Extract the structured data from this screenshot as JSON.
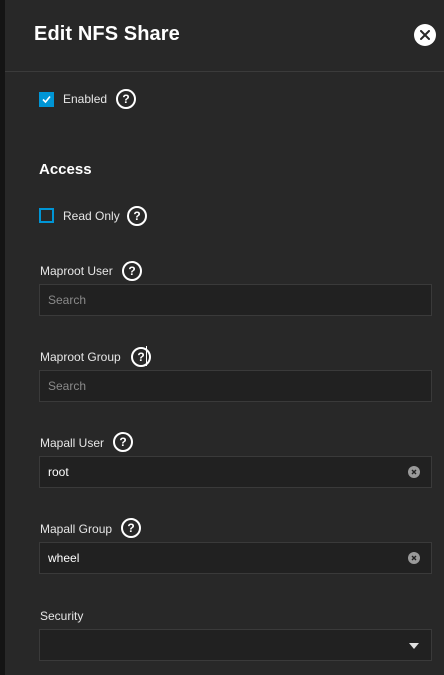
{
  "dialog": {
    "title": "Edit NFS Share",
    "close_icon": "close-icon"
  },
  "general": {
    "enabled_label": "Enabled",
    "enabled_checked": true
  },
  "access": {
    "section_title": "Access",
    "read_only_label": "Read Only",
    "read_only_checked": false,
    "maproot_user": {
      "label": "Maproot User",
      "value": "",
      "placeholder": "Search"
    },
    "maproot_group": {
      "label": "Maproot Group",
      "value": "",
      "placeholder": "Search"
    },
    "mapall_user": {
      "label": "Mapall User",
      "value": "root"
    },
    "mapall_group": {
      "label": "Mapall Group",
      "value": "wheel"
    },
    "security": {
      "label": "Security",
      "value": ""
    }
  },
  "icons": {
    "help": "help-circle-icon",
    "help_glyph": "?",
    "clear": "clear-icon",
    "dropdown": "chevron-down-icon"
  },
  "colors": {
    "accent": "#0095d5",
    "panel": "#282828",
    "input_bg": "#212121"
  }
}
